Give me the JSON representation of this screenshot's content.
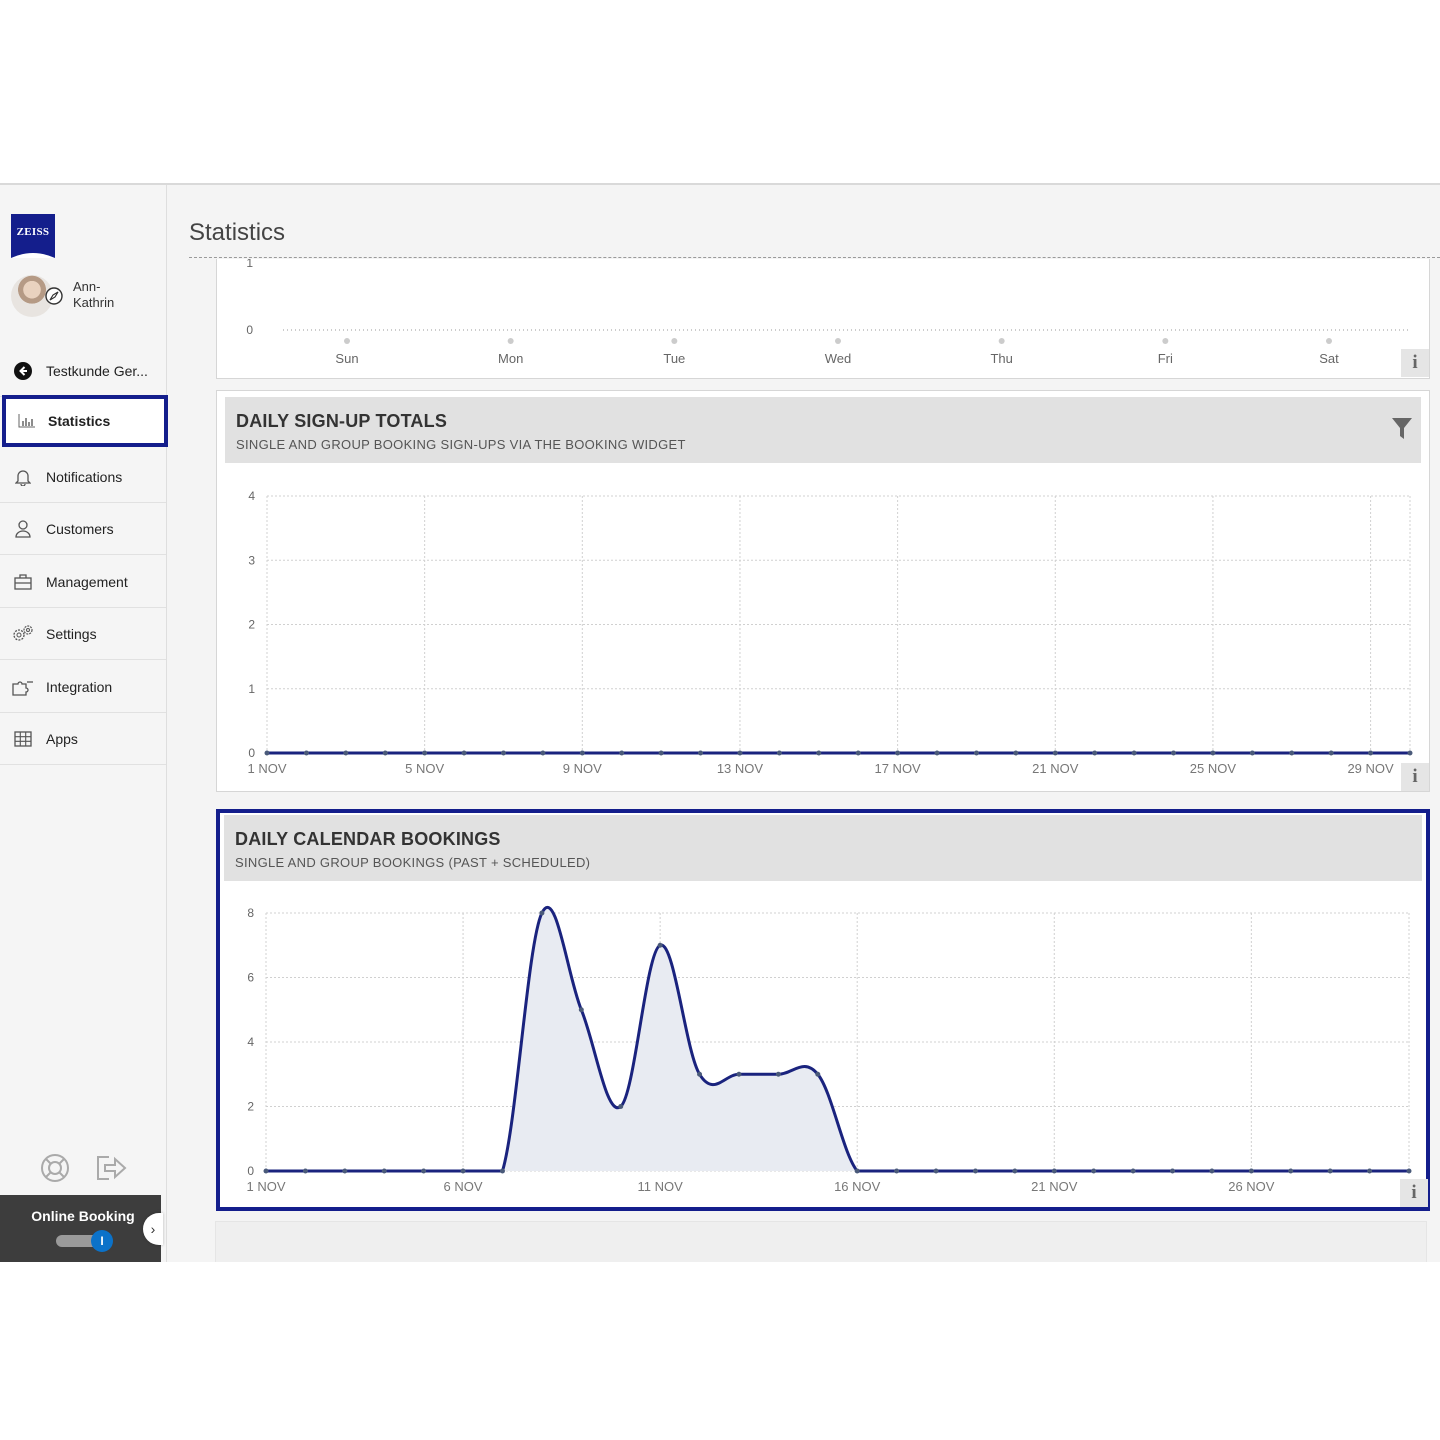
{
  "sidebar": {
    "logo": "ZEISS",
    "user_name": "Ann-Kathrin",
    "items": [
      {
        "label": "Testkunde Ger...",
        "icon": "back-arrow-icon"
      },
      {
        "label": "Statistics",
        "icon": "bar-chart-icon"
      },
      {
        "label": "Notifications",
        "icon": "bell-icon"
      },
      {
        "label": "Customers",
        "icon": "user-icon"
      },
      {
        "label": "Management",
        "icon": "briefcase-icon"
      },
      {
        "label": "Settings",
        "icon": "gears-icon"
      },
      {
        "label": "Integration",
        "icon": "puzzle-icon"
      },
      {
        "label": "Apps",
        "icon": "grid-icon"
      }
    ],
    "footer_icons": [
      "help-icon",
      "logout-icon"
    ],
    "online_booking": {
      "label": "Online Booking",
      "toggle_symbol": "I",
      "enabled": true
    }
  },
  "main": {
    "page_title": "Statistics"
  },
  "chart_data": [
    {
      "type": "line",
      "categories": [
        "Sun",
        "Mon",
        "Tue",
        "Wed",
        "Thu",
        "Fri",
        "Sat"
      ],
      "values": [
        0,
        0,
        0,
        0,
        0,
        0,
        0
      ],
      "visible_y_ticks": [
        "0"
      ],
      "partial_tick": "1"
    },
    {
      "type": "line",
      "title": "DAILY SIGN-UP TOTALS",
      "subtitle": "SINGLE AND GROUP BOOKING SIGN-UPS VIA THE BOOKING WIDGET",
      "x_tick_labels": [
        "1 NOV",
        "5 NOV",
        "9 NOV",
        "13 NOV",
        "17 NOV",
        "21 NOV",
        "25 NOV",
        "29 NOV"
      ],
      "x_days": [
        1,
        2,
        3,
        4,
        5,
        6,
        7,
        8,
        9,
        10,
        11,
        12,
        13,
        14,
        15,
        16,
        17,
        18,
        19,
        20,
        21,
        22,
        23,
        24,
        25,
        26,
        27,
        28,
        29,
        30
      ],
      "values": [
        0,
        0,
        0,
        0,
        0,
        0,
        0,
        0,
        0,
        0,
        0,
        0,
        0,
        0,
        0,
        0,
        0,
        0,
        0,
        0,
        0,
        0,
        0,
        0,
        0,
        0,
        0,
        0,
        0,
        0
      ],
      "y_ticks": [
        "0",
        "1",
        "2",
        "3",
        "4"
      ],
      "ylim": [
        0,
        4
      ],
      "grid": true
    },
    {
      "type": "area",
      "title": "DAILY CALENDAR BOOKINGS",
      "subtitle": "SINGLE AND GROUP BOOKINGS (PAST + SCHEDULED)",
      "x_tick_labels": [
        "1 NOV",
        "6 NOV",
        "11 NOV",
        "16 NOV",
        "21 NOV",
        "26 NOV"
      ],
      "x_days": [
        1,
        2,
        3,
        4,
        5,
        6,
        7,
        8,
        9,
        10,
        11,
        12,
        13,
        14,
        15,
        16,
        17,
        18,
        19,
        20,
        21,
        22,
        23,
        24,
        25,
        26,
        27,
        28,
        29,
        30
      ],
      "values": [
        0,
        0,
        0,
        0,
        0,
        0,
        0,
        8,
        5,
        2,
        7,
        3,
        3,
        3,
        3,
        0,
        0,
        0,
        0,
        0,
        0,
        0,
        0,
        0,
        0,
        0,
        0,
        0,
        0,
        0
      ],
      "y_ticks": [
        "0",
        "2",
        "4",
        "6",
        "8"
      ],
      "ylim": [
        0,
        8
      ],
      "grid": true
    }
  ],
  "colors": {
    "accent": "#141e8c",
    "series": "#1a237e",
    "area_fill": "#e8ebf2"
  }
}
